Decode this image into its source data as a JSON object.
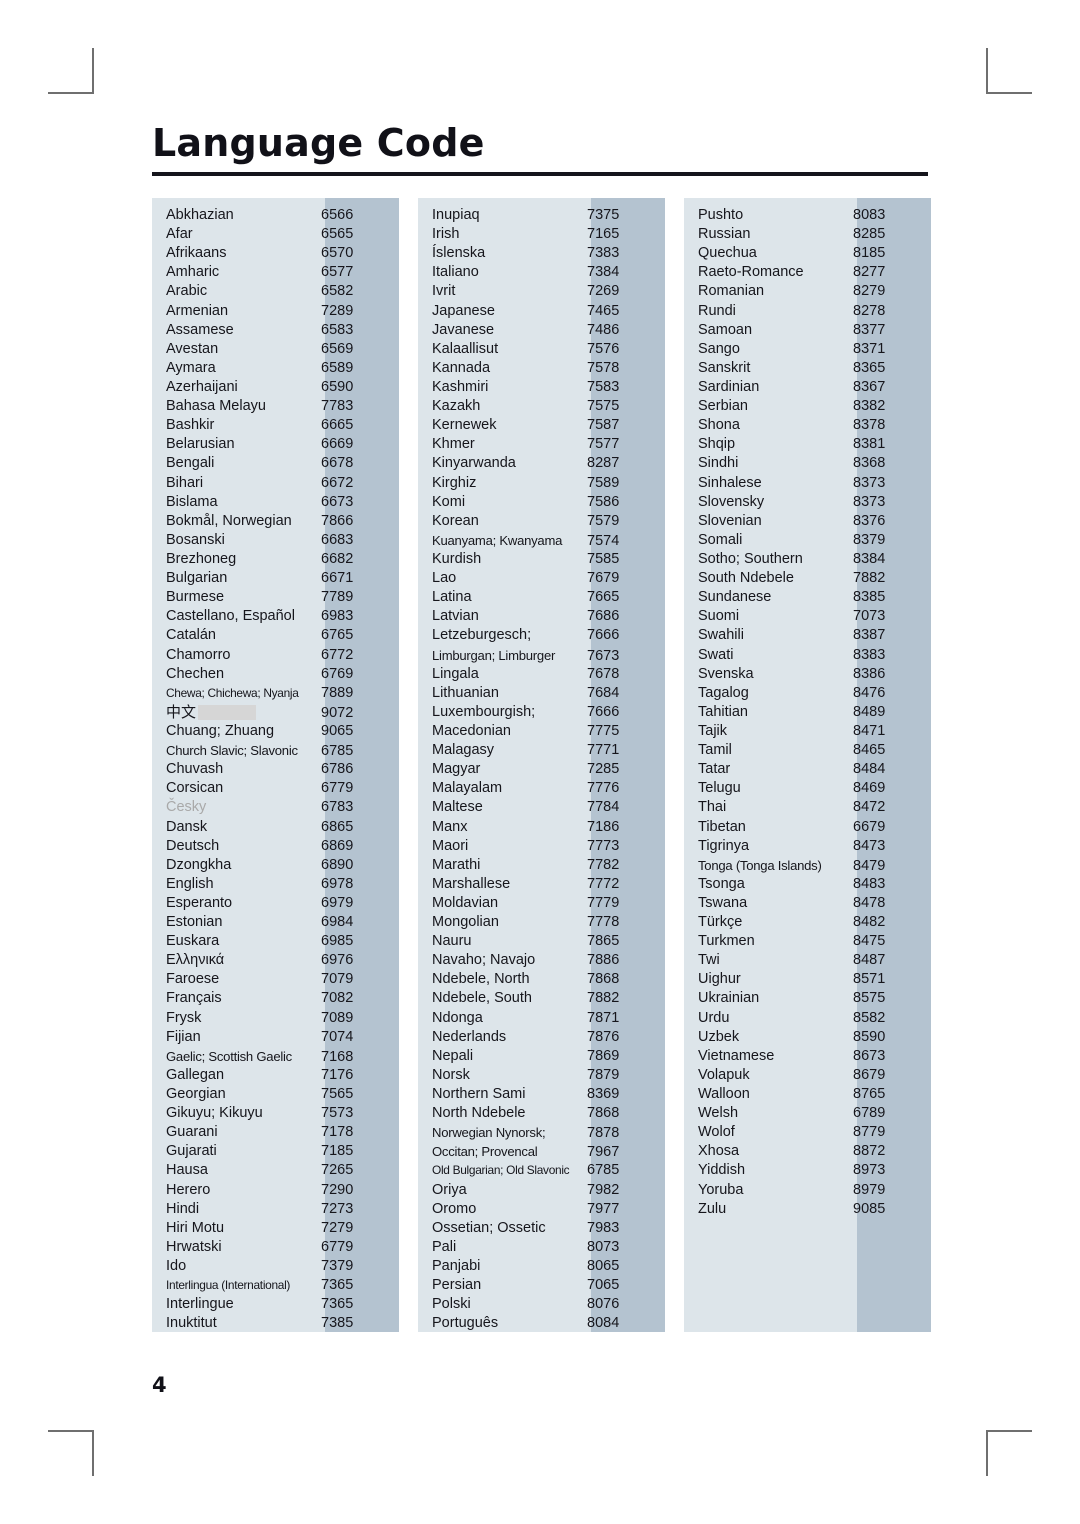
{
  "document": {
    "title": "Language Code",
    "page_number": "4"
  },
  "table": {
    "columns": [
      {
        "id": "column-1",
        "rows": [
          {
            "name": "Abkhazian",
            "code": "6566"
          },
          {
            "name": "Afar",
            "code": "6565"
          },
          {
            "name": "Afrikaans",
            "code": "6570"
          },
          {
            "name": "Amharic",
            "code": "6577"
          },
          {
            "name": "Arabic",
            "code": "6582"
          },
          {
            "name": "Armenian",
            "code": "7289"
          },
          {
            "name": "Assamese",
            "code": "6583"
          },
          {
            "name": "Avestan",
            "code": "6569"
          },
          {
            "name": "Aymara",
            "code": "6589"
          },
          {
            "name": "Azerhaijani",
            "code": "6590"
          },
          {
            "name": "Bahasa Melayu",
            "code": "7783"
          },
          {
            "name": "Bashkir",
            "code": "6665"
          },
          {
            "name": "Belarusian",
            "code": "6669"
          },
          {
            "name": "Bengali",
            "code": "6678"
          },
          {
            "name": "Bihari",
            "code": "6672"
          },
          {
            "name": "Bislama",
            "code": "6673"
          },
          {
            "name": "Bokmål, Norwegian",
            "code": "7866"
          },
          {
            "name": "Bosanski",
            "code": "6683"
          },
          {
            "name": "Brezhoneg",
            "code": "6682"
          },
          {
            "name": "Bulgarian",
            "code": "6671"
          },
          {
            "name": "Burmese",
            "code": "7789"
          },
          {
            "name": "Castellano, Español",
            "code": "6983"
          },
          {
            "name": "Catalán",
            "code": "6765"
          },
          {
            "name": "Chamorro",
            "code": "6772"
          },
          {
            "name": "Chechen",
            "code": "6769"
          },
          {
            "name": "Chewa; Chichewa; Nyanja",
            "code": "7889",
            "size": "tight2"
          },
          {
            "name": "中文",
            "code": "9072",
            "style": "cjk-redacted"
          },
          {
            "name": "Chuang; Zhuang",
            "code": "9065"
          },
          {
            "name": "Church Slavic; Slavonic",
            "code": "6785",
            "size": "tight"
          },
          {
            "name": "Chuvash",
            "code": "6786"
          },
          {
            "name": "Corsican",
            "code": "6779"
          },
          {
            "name": "Česky",
            "code": "6783",
            "style": "faded"
          },
          {
            "name": "Dansk",
            "code": "6865"
          },
          {
            "name": "Deutsch",
            "code": "6869"
          },
          {
            "name": "Dzongkha",
            "code": "6890"
          },
          {
            "name": "English",
            "code": "6978"
          },
          {
            "name": "Esperanto",
            "code": "6979"
          },
          {
            "name": "Estonian",
            "code": "6984"
          },
          {
            "name": "Euskara",
            "code": "6985"
          },
          {
            "name": "Ελληνικά",
            "code": "6976"
          },
          {
            "name": "Faroese",
            "code": "7079"
          },
          {
            "name": "Français",
            "code": "7082"
          },
          {
            "name": "Frysk",
            "code": "7089"
          },
          {
            "name": "Fijian",
            "code": "7074"
          },
          {
            "name": "Gaelic; Scottish Gaelic",
            "code": "7168",
            "size": "tight"
          },
          {
            "name": "Gallegan",
            "code": "7176"
          },
          {
            "name": "Georgian",
            "code": "7565"
          },
          {
            "name": "Gikuyu; Kikuyu",
            "code": "7573"
          },
          {
            "name": "Guarani",
            "code": "7178"
          },
          {
            "name": "Gujarati",
            "code": "7185"
          },
          {
            "name": "Hausa",
            "code": "7265"
          },
          {
            "name": "Herero",
            "code": "7290"
          },
          {
            "name": "Hindi",
            "code": "7273"
          },
          {
            "name": "Hiri Motu",
            "code": "7279"
          },
          {
            "name": "Hrwatski",
            "code": "6779"
          },
          {
            "name": "Ido",
            "code": "7379"
          },
          {
            "name": "Interlingua (International)",
            "code": "7365",
            "size": "tight2"
          },
          {
            "name": "Interlingue",
            "code": "7365"
          },
          {
            "name": "Inuktitut",
            "code": "7385"
          }
        ]
      },
      {
        "id": "column-2",
        "rows": [
          {
            "name": "Inupiaq",
            "code": "7375"
          },
          {
            "name": "Irish",
            "code": "7165"
          },
          {
            "name": "Íslenska",
            "code": "7383"
          },
          {
            "name": "Italiano",
            "code": "7384"
          },
          {
            "name": "Ivrit",
            "code": "7269"
          },
          {
            "name": "Japanese",
            "code": "7465"
          },
          {
            "name": "Javanese",
            "code": "7486"
          },
          {
            "name": "Kalaallisut",
            "code": "7576"
          },
          {
            "name": "Kannada",
            "code": "7578"
          },
          {
            "name": "Kashmiri",
            "code": "7583"
          },
          {
            "name": "Kazakh",
            "code": "7575"
          },
          {
            "name": "Kernewek",
            "code": "7587"
          },
          {
            "name": "Khmer",
            "code": "7577"
          },
          {
            "name": "Kinyarwanda",
            "code": "8287"
          },
          {
            "name": "Kirghiz",
            "code": "7589"
          },
          {
            "name": "Komi",
            "code": "7586"
          },
          {
            "name": "Korean",
            "code": "7579"
          },
          {
            "name": "Kuanyama; Kwanyama",
            "code": "7574",
            "size": "tight"
          },
          {
            "name": "Kurdish",
            "code": "7585"
          },
          {
            "name": "Lao",
            "code": "7679"
          },
          {
            "name": "Latina",
            "code": "7665"
          },
          {
            "name": "Latvian",
            "code": "7686"
          },
          {
            "name": "Letzeburgesch;",
            "code": "7666"
          },
          {
            "name": "Limburgan; Limburger",
            "code": "7673",
            "size": "tight"
          },
          {
            "name": "Lingala",
            "code": "7678"
          },
          {
            "name": "Lithuanian",
            "code": "7684"
          },
          {
            "name": "Luxembourgish;",
            "code": "7666"
          },
          {
            "name": "Macedonian",
            "code": "7775"
          },
          {
            "name": "Malagasy",
            "code": "7771"
          },
          {
            "name": "Magyar",
            "code": "7285"
          },
          {
            "name": "Malayalam",
            "code": "7776"
          },
          {
            "name": "Maltese",
            "code": "7784"
          },
          {
            "name": "Manx",
            "code": "7186"
          },
          {
            "name": "Maori",
            "code": "7773"
          },
          {
            "name": "Marathi",
            "code": "7782"
          },
          {
            "name": "Marshallese",
            "code": "7772"
          },
          {
            "name": "Moldavian",
            "code": "7779"
          },
          {
            "name": "Mongolian",
            "code": "7778"
          },
          {
            "name": "Nauru",
            "code": "7865"
          },
          {
            "name": "Navaho; Navajo",
            "code": "7886"
          },
          {
            "name": "Ndebele, North",
            "code": "7868"
          },
          {
            "name": "Ndebele, South",
            "code": "7882"
          },
          {
            "name": "Ndonga",
            "code": "7871"
          },
          {
            "name": "Nederlands",
            "code": "7876"
          },
          {
            "name": "Nepali",
            "code": "7869"
          },
          {
            "name": "Norsk",
            "code": "7879"
          },
          {
            "name": "Northern Sami",
            "code": "8369"
          },
          {
            "name": "North Ndebele",
            "code": "7868"
          },
          {
            "name": "Norwegian Nynorsk;",
            "code": "7878",
            "size": "tight"
          },
          {
            "name": "Occitan; Provencal",
            "code": "7967",
            "size": "tight"
          },
          {
            "name": "Old Bulgarian; Old Slavonic",
            "code": "6785",
            "size": "tight2"
          },
          {
            "name": "Oriya",
            "code": "7982"
          },
          {
            "name": "Oromo",
            "code": "7977"
          },
          {
            "name": "Ossetian; Ossetic",
            "code": "7983"
          },
          {
            "name": "Pali",
            "code": "8073"
          },
          {
            "name": "Panjabi",
            "code": "8065"
          },
          {
            "name": "Persian",
            "code": "7065"
          },
          {
            "name": "Polski",
            "code": "8076"
          },
          {
            "name": "Português",
            "code": "8084"
          }
        ]
      },
      {
        "id": "column-3",
        "rows": [
          {
            "name": "Pushto",
            "code": "8083"
          },
          {
            "name": "Russian",
            "code": "8285"
          },
          {
            "name": "Quechua",
            "code": "8185"
          },
          {
            "name": "Raeto-Romance",
            "code": "8277"
          },
          {
            "name": "Romanian",
            "code": "8279"
          },
          {
            "name": "Rundi",
            "code": "8278"
          },
          {
            "name": "Samoan",
            "code": "8377"
          },
          {
            "name": "Sango",
            "code": "8371"
          },
          {
            "name": "Sanskrit",
            "code": "8365"
          },
          {
            "name": "Sardinian",
            "code": "8367"
          },
          {
            "name": "Serbian",
            "code": "8382"
          },
          {
            "name": "Shona",
            "code": "8378"
          },
          {
            "name": "Shqip",
            "code": "8381"
          },
          {
            "name": "Sindhi",
            "code": "8368"
          },
          {
            "name": "Sinhalese",
            "code": "8373"
          },
          {
            "name": "Slovensky",
            "code": "8373"
          },
          {
            "name": "Slovenian",
            "code": "8376"
          },
          {
            "name": "Somali",
            "code": "8379"
          },
          {
            "name": "Sotho; Southern",
            "code": "8384"
          },
          {
            "name": "South Ndebele",
            "code": "7882"
          },
          {
            "name": "Sundanese",
            "code": "8385"
          },
          {
            "name": "Suomi",
            "code": "7073"
          },
          {
            "name": "Swahili",
            "code": "8387"
          },
          {
            "name": "Swati",
            "code": "8383"
          },
          {
            "name": "Svenska",
            "code": "8386"
          },
          {
            "name": "Tagalog",
            "code": "8476"
          },
          {
            "name": "Tahitian",
            "code": "8489"
          },
          {
            "name": "Tajik",
            "code": "8471"
          },
          {
            "name": "Tamil",
            "code": "8465"
          },
          {
            "name": "Tatar",
            "code": "8484"
          },
          {
            "name": "Telugu",
            "code": "8469"
          },
          {
            "name": "Thai",
            "code": "8472"
          },
          {
            "name": "Tibetan",
            "code": "6679"
          },
          {
            "name": "Tigrinya",
            "code": "8473"
          },
          {
            "name": "Tonga (Tonga Islands)",
            "code": "8479",
            "size": "tight"
          },
          {
            "name": "Tsonga",
            "code": "8483"
          },
          {
            "name": "Tswana",
            "code": "8478"
          },
          {
            "name": "Türkçe",
            "code": "8482"
          },
          {
            "name": "Turkmen",
            "code": "8475"
          },
          {
            "name": "Twi",
            "code": "8487"
          },
          {
            "name": "Uighur",
            "code": "8571"
          },
          {
            "name": "Ukrainian",
            "code": "8575"
          },
          {
            "name": "Urdu",
            "code": "8582"
          },
          {
            "name": "Uzbek",
            "code": "8590"
          },
          {
            "name": "Vietnamese",
            "code": "8673"
          },
          {
            "name": "Volapuk",
            "code": "8679"
          },
          {
            "name": "Walloon",
            "code": "8765"
          },
          {
            "name": "Welsh",
            "code": "6789"
          },
          {
            "name": "Wolof",
            "code": "8779"
          },
          {
            "name": "Xhosa",
            "code": "8872"
          },
          {
            "name": "Yiddish",
            "code": "8973"
          },
          {
            "name": "Yoruba",
            "code": "8979"
          },
          {
            "name": "Zulu",
            "code": "9085"
          }
        ]
      }
    ]
  },
  "colors": {
    "name_cell_bg": "#dde5ea",
    "code_cell_bg": "#b4c3d0",
    "title_rule": "#15151c",
    "redaction": "#d6d6d6",
    "faded_text": "#a9a9a9"
  }
}
